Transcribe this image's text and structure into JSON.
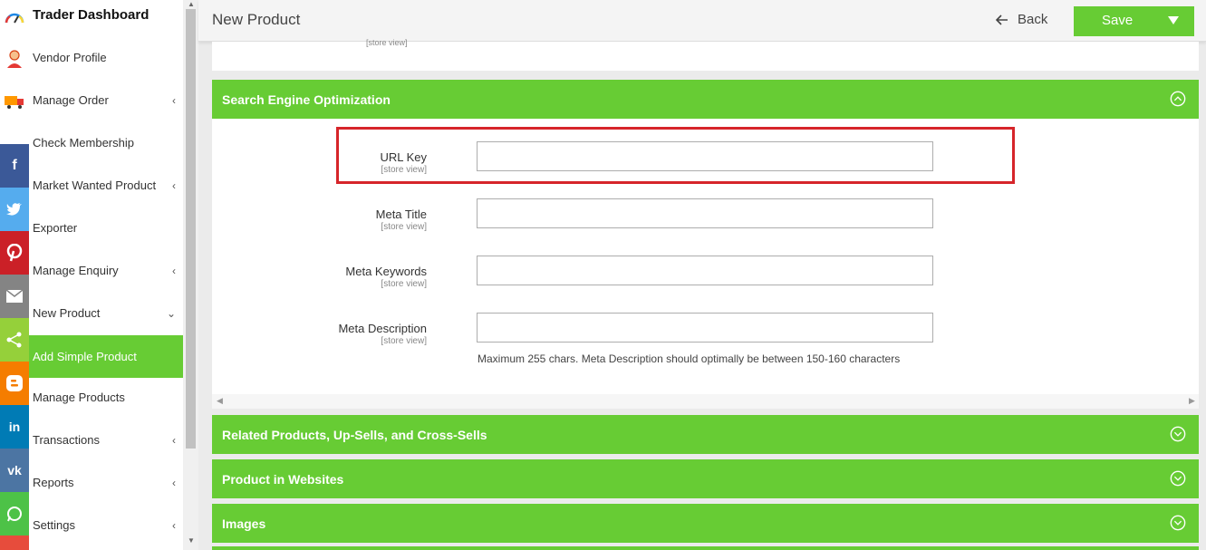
{
  "sidebar": {
    "brand": "Trader Dashboard",
    "items": [
      {
        "label": "Vendor Profile",
        "chevron": ""
      },
      {
        "label": "Manage Order",
        "chevron": "‹"
      },
      {
        "label": "Check Membership",
        "chevron": ""
      },
      {
        "label": "Market Wanted Product",
        "chevron": "‹"
      },
      {
        "label": "Exporter",
        "chevron": ""
      },
      {
        "label": "Manage Enquiry",
        "chevron": "‹"
      },
      {
        "label": "New Product",
        "chevron": "⌄"
      },
      {
        "label": "Add Simple Product",
        "chevron": ""
      },
      {
        "label": "Manage Products",
        "chevron": ""
      },
      {
        "label": "Transactions",
        "chevron": "‹"
      },
      {
        "label": "Reports",
        "chevron": "‹"
      },
      {
        "label": "Settings",
        "chevron": "‹"
      }
    ]
  },
  "share": {
    "facebook": "f",
    "linkedin": "in",
    "vk": "vk"
  },
  "colors": {
    "accent": "#67cc34",
    "highlight": "#d6252a",
    "facebook": "#3b5998",
    "twitter": "#55acee",
    "pinterest": "#cb2027",
    "email": "#848484",
    "sharethis": "#95d03a",
    "blogger": "#f57d00",
    "linkedin": "#007bb5",
    "vk": "#4c75a3",
    "whatsapp": "#4dc247"
  },
  "header": {
    "title": "New Product",
    "back_label": "Back",
    "save_label": "Save"
  },
  "top_panel": {
    "scope": "[store view]"
  },
  "seo": {
    "title": "Search Engine Optimization",
    "fields": [
      {
        "label": "URL Key",
        "scope": "[store view]",
        "value": ""
      },
      {
        "label": "Meta Title",
        "scope": "[store view]",
        "value": ""
      },
      {
        "label": "Meta Keywords",
        "scope": "[store view]",
        "value": ""
      },
      {
        "label": "Meta Description",
        "scope": "[store view]",
        "value": ""
      }
    ],
    "hint": "Maximum 255 chars. Meta Description should optimally be between 150-160 characters"
  },
  "sections": [
    {
      "title": "Related Products, Up-Sells, and Cross-Sells"
    },
    {
      "title": "Product in Websites"
    },
    {
      "title": "Images"
    }
  ]
}
